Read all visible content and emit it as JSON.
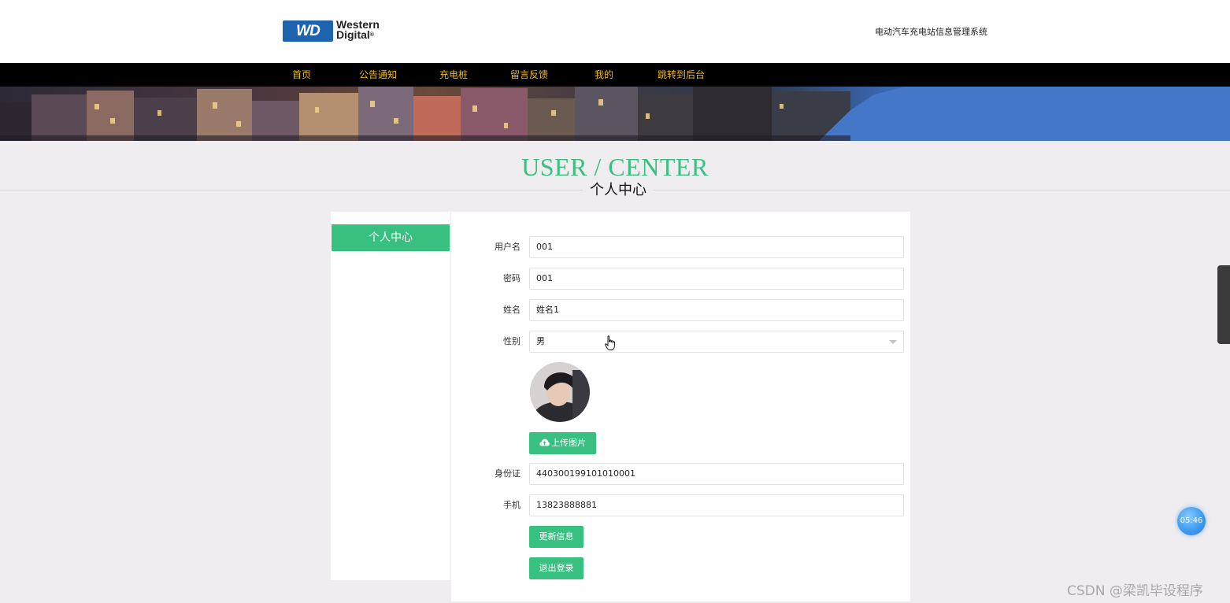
{
  "header": {
    "logo_box": "WD",
    "logo_line1": "Western",
    "logo_line2": "Digital",
    "logo_reg": "®",
    "site_title": "电动汽车充电站信息管理系统"
  },
  "nav": {
    "items": [
      {
        "label": "首页"
      },
      {
        "label": "公告通知"
      },
      {
        "label": "充电桩"
      },
      {
        "label": "留言反馈"
      },
      {
        "label": "我的"
      },
      {
        "label": "跳转到后台"
      }
    ]
  },
  "section": {
    "en_title": "USER / CENTER",
    "cn_title": "个人中心"
  },
  "sidebar": {
    "items": [
      {
        "label": "个人中心"
      }
    ]
  },
  "form": {
    "username": {
      "label": "用户名",
      "value": "001"
    },
    "password": {
      "label": "密码",
      "value": "001"
    },
    "name": {
      "label": "姓名",
      "value": "姓名1"
    },
    "gender": {
      "label": "性别",
      "value": "男"
    },
    "upload_button": "上传图片",
    "id_card": {
      "label": "身份证",
      "value": "440300199101010001"
    },
    "phone": {
      "label": "手机",
      "value": "13823888881"
    },
    "update_button": "更新信息",
    "logout_button": "退出登录"
  },
  "overlay": {
    "timer": "05:46",
    "watermark": "CSDN @梁凯毕设程序"
  },
  "colors": {
    "accent": "#37c080",
    "nav_bg": "#000000",
    "nav_text": "#f2b90c",
    "page_bg": "#efedf0"
  },
  "icons": [
    "cloud-upload-icon",
    "hand-cursor-icon",
    "chevron-down-icon"
  ]
}
